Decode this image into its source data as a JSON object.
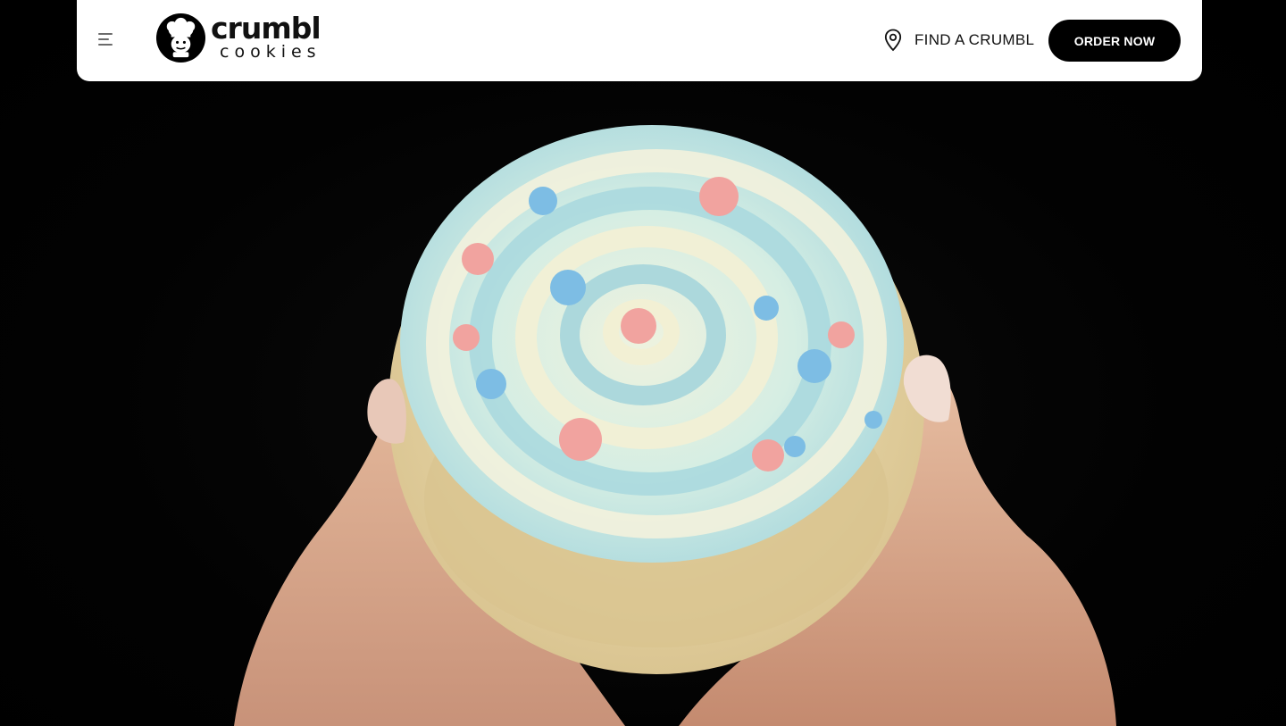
{
  "navbar": {
    "logo": {
      "wordmark": "crumbl",
      "subtitle": "cookies"
    },
    "find_label": "FIND A CRUMBL",
    "order_label": "ORDER NOW"
  },
  "icons": {
    "menu": "hamburger-menu-icon",
    "logo": "chef-logo-icon",
    "pin": "map-pin-icon"
  },
  "colors": {
    "navbar_bg": "#ffffff",
    "button_bg": "#000000",
    "button_text": "#ffffff",
    "hero_bg": "#000000",
    "frosting_blue": "#a9d9e0",
    "frosting_cream": "#f4f0d6",
    "sprinkle_pink": "#f3a3a0",
    "sprinkle_blue": "#7fbfe6"
  }
}
